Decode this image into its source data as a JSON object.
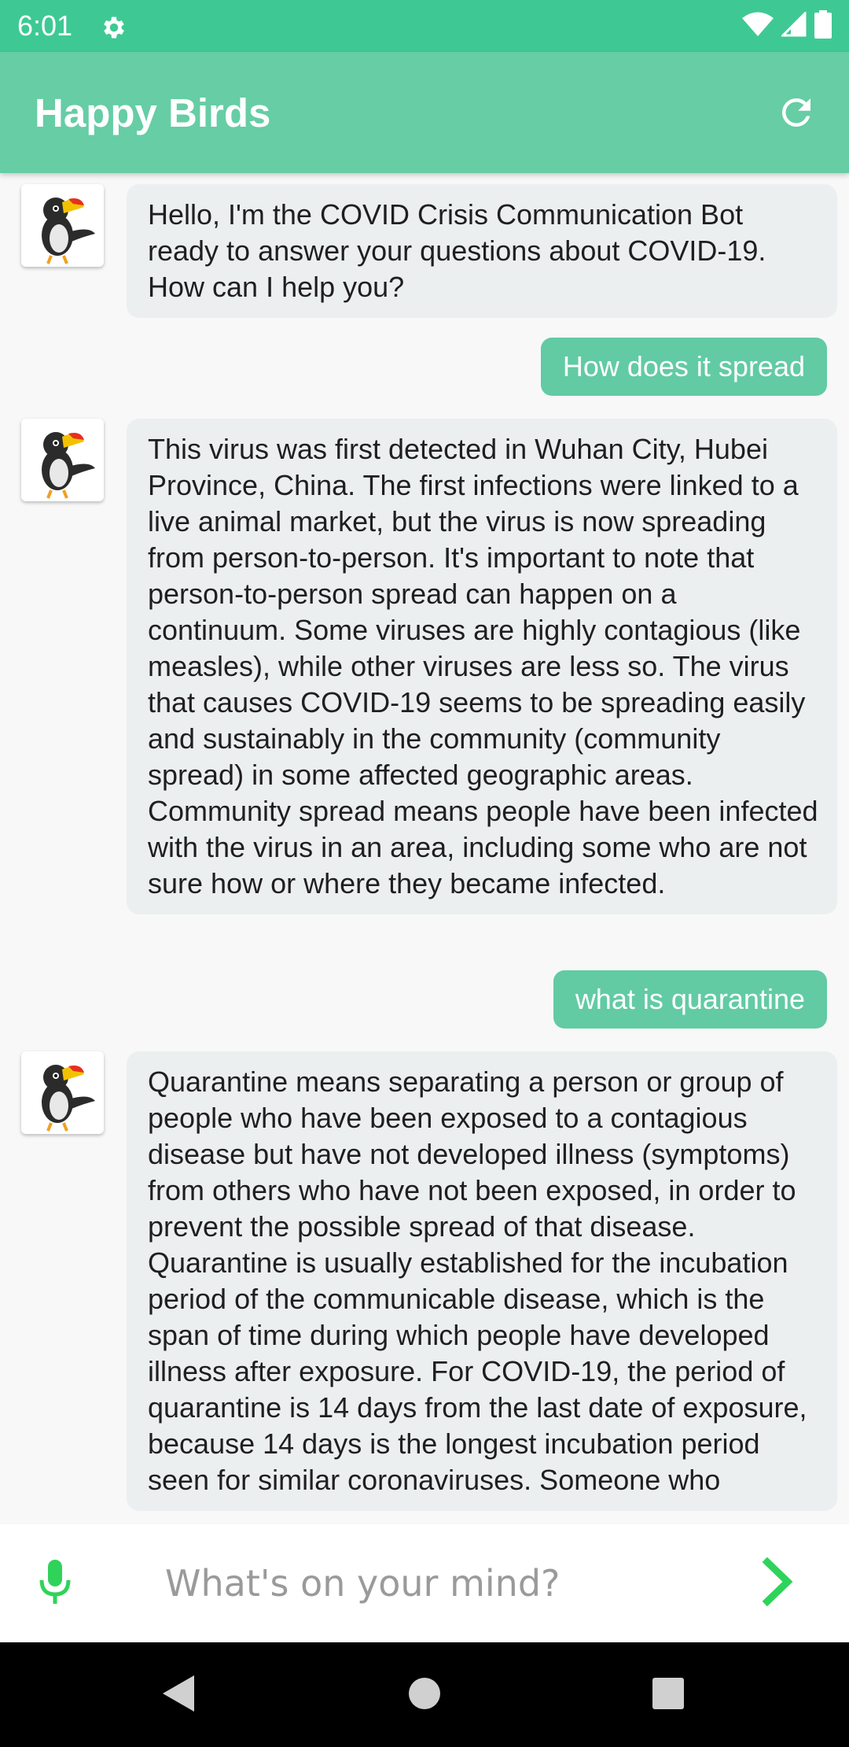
{
  "status_bar": {
    "time": "6:01",
    "icons": [
      "gear-icon",
      "wifi-icon",
      "signal-icon",
      "battery-icon"
    ]
  },
  "app_bar": {
    "title": "Happy Birds",
    "refresh_icon": "refresh-icon"
  },
  "messages": [
    {
      "sender": "bot",
      "text": "Hello, I'm the COVID Crisis Communication Bot ready to answer your questions about COVID-19. How can I help you?"
    },
    {
      "sender": "user",
      "text": "How does it spread"
    },
    {
      "sender": "bot",
      "text": "This virus was first detected in Wuhan City, Hubei Province, China. The first infections were linked to a live animal market, but the virus is now spreading from person-to-person. It's important to note that person-to-person spread can happen on a continuum. Some viruses are highly contagious (like measles), while other viruses are less so. The virus that causes COVID-19 seems to be spreading easily and sustainably in the community (community spread) in some affected geographic areas. Community spread means people have been infected with the virus in an area, including some who are not sure how or where they became infected."
    },
    {
      "sender": "user",
      "text": "what is quarantine"
    },
    {
      "sender": "bot",
      "text": "Quarantine means separating a person or group of people who have been exposed to a contagious disease but have not developed illness (symptoms) from others who have not been exposed, in order to prevent the possible spread of that disease. Quarantine is usually established for the incubation period of the communicable disease, which is the span of time during which people have developed illness after exposure. For COVID-19, the period of quarantine is 14 days from the last date of exposure, because 14 days is the longest incubation period seen for similar coronaviruses. Someone who"
    }
  ],
  "input": {
    "placeholder": "What's on your mind?",
    "value": "",
    "mic_icon": "microphone-icon",
    "send_icon": "send-chevron-icon"
  },
  "nav_bar": {
    "icons": [
      "back-triangle-icon",
      "home-circle-icon",
      "recents-square-icon"
    ]
  },
  "colors": {
    "status_bar": "#3ec994",
    "app_bar": "#66cda5",
    "user_bubble": "#62cba3",
    "bot_bubble": "#eceff0",
    "accent_green": "#2fd35a"
  }
}
